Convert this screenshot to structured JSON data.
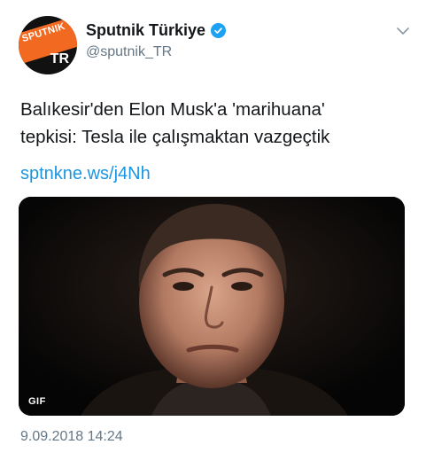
{
  "author": {
    "avatar_brand": "SPUTNIK",
    "avatar_badge": "TR",
    "display_name": "Sputnik Türkiye",
    "handle": "@sputnik_TR",
    "verified": true
  },
  "tweet": {
    "text_line1": "Balıkesir'den Elon Musk'a 'marihuana'",
    "text_line2": "tepkisi: Tesla ile çalışmaktan vazgeçtik",
    "link": "sptnkne.ws/j4Nh",
    "media_badge": "GIF",
    "timestamp": "9.09.2018 14:24"
  },
  "colors": {
    "link": "#1b95e0",
    "verified": "#1da1f2",
    "brand_orange": "#f26a21",
    "secondary_text": "#657786"
  },
  "icons": {
    "verified": "verified-badge-icon",
    "menu": "chevron-down-icon"
  }
}
